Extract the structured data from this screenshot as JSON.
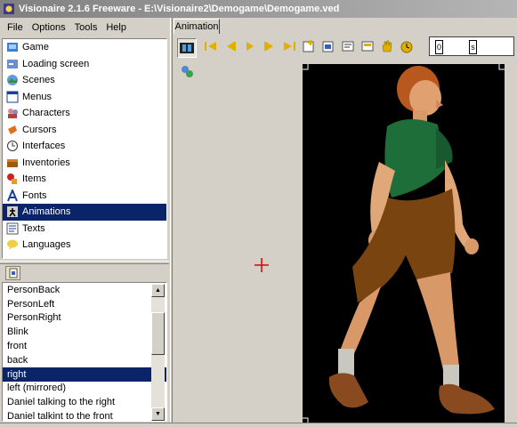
{
  "window": {
    "title": "Visionaire 2.1.6 Freeware - E:\\Visionaire2\\Demogame\\Demogame.ved"
  },
  "menubar": {
    "items": [
      "File",
      "Options",
      "Tools",
      "Help"
    ]
  },
  "categories": {
    "items": [
      {
        "label": "Game",
        "icon": "game-icon"
      },
      {
        "label": "Loading screen",
        "icon": "loading-screen-icon"
      },
      {
        "label": "Scenes",
        "icon": "scenes-icon"
      },
      {
        "label": "Menus",
        "icon": "menus-icon"
      },
      {
        "label": "Characters",
        "icon": "characters-icon"
      },
      {
        "label": "Cursors",
        "icon": "cursors-icon"
      },
      {
        "label": "Interfaces",
        "icon": "interfaces-icon"
      },
      {
        "label": "Inventories",
        "icon": "inventories-icon"
      },
      {
        "label": "Items",
        "icon": "items-icon"
      },
      {
        "label": "Fonts",
        "icon": "fonts-icon"
      },
      {
        "label": "Animations",
        "icon": "animations-icon"
      },
      {
        "label": "Texts",
        "icon": "texts-icon"
      },
      {
        "label": "Languages",
        "icon": "languages-icon"
      }
    ],
    "selected": "Animations"
  },
  "animation_list": {
    "items": [
      "PersonBack",
      "PersonLeft",
      "PersonRight",
      "Blink",
      "front",
      "back",
      "right",
      "left (mirrored)",
      "Daniel talking to the right",
      "Daniel talkint to the front"
    ],
    "selected": "right"
  },
  "editor": {
    "tab_label": "Animation"
  },
  "frame_strip": {
    "markers": [
      "0",
      "s"
    ]
  },
  "colors": {
    "selection": "#0a246a",
    "toolbar_icon": "#e0b000",
    "crosshair": "#e00000",
    "shirt": "#1e6e3a",
    "shorts": "#7a4410"
  }
}
